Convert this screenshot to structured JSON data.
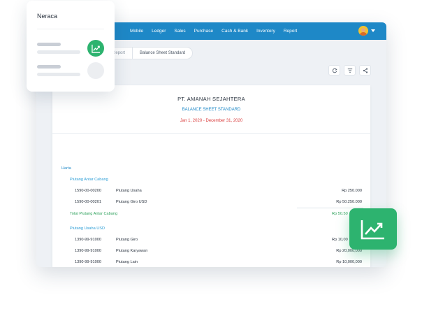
{
  "nav": {
    "items": [
      "Mobile",
      "Ledger",
      "Sales",
      "Purchase",
      "Cash & Bank",
      "Inventory",
      "Report"
    ]
  },
  "breadcrumb": {
    "prev": "Report",
    "current": "Balance Sheet Standard"
  },
  "report": {
    "company": "PT. AMANAH SEJAHTERA",
    "title": "BALANCE SHEET STANDARD",
    "period": "Jan 1, 2020 - December 31, 2020",
    "section": "Harta",
    "groups": [
      {
        "name": "Piutang Antar Cabang",
        "rows": [
          {
            "code": "1590-00-00200",
            "name": "Piutang Usaha",
            "amount": "Rp 250.000"
          },
          {
            "code": "1590-00-00201",
            "name": "Piutang Giro USD",
            "amount": "Rp 50.250.000"
          }
        ],
        "total_label": "Total Piutang Antar Cabang",
        "total_amount": "Rp 50.50"
      },
      {
        "name": "Piutang Usaha USD",
        "rows": [
          {
            "code": "1390-99-91000",
            "name": "Piutang Giro",
            "amount": "Rp 10,00"
          },
          {
            "code": "1390-99-91000",
            "name": "Piutang Karyawan",
            "amount": "Rp 20,000,000"
          },
          {
            "code": "1390-99-91000",
            "name": "Piutang Lain",
            "amount": "Rp 10,000,000"
          }
        ]
      }
    ]
  },
  "card": {
    "title": "Neraca"
  },
  "colors": {
    "topbar": "#1e88c7",
    "accent_green": "#2db36f",
    "period_red": "#d93a3a"
  },
  "icons": {
    "refresh": "refresh-icon",
    "filter": "filter-icon",
    "share": "share-icon",
    "chart": "trending-up-icon"
  }
}
